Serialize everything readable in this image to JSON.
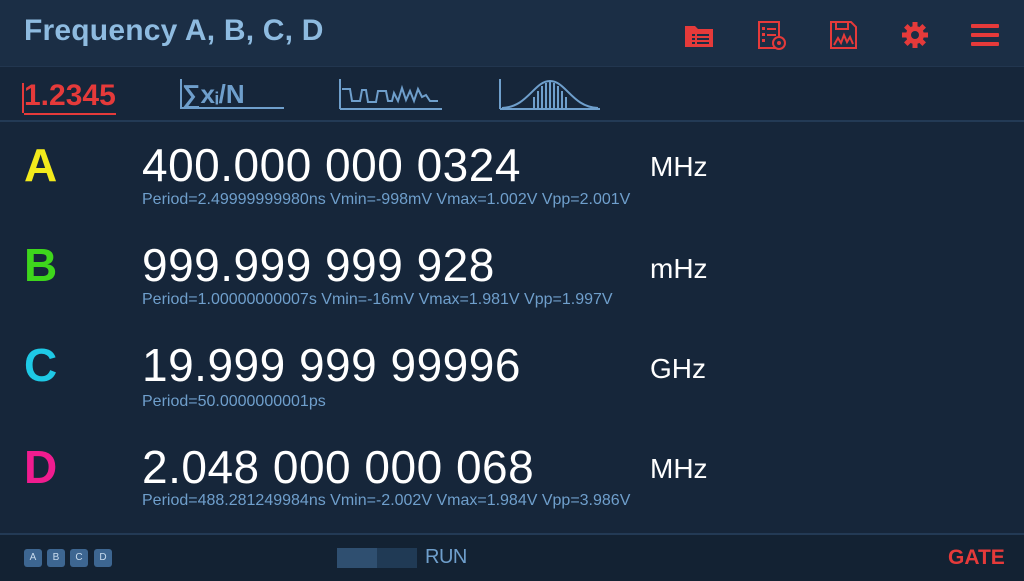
{
  "header": {
    "title": "Frequency A, B, C, D",
    "icons": [
      "folder-list-icon",
      "settings-list-icon",
      "save-chart-icon",
      "gear-icon",
      "menu-icon"
    ],
    "accent": "#e53a3a"
  },
  "modes": {
    "numeric_label": "1.2345",
    "stats_label": "∑xᵢ/N",
    "items": [
      "numeric-mode",
      "statistics-mode",
      "trend-mode",
      "histogram-mode"
    ]
  },
  "channels": [
    {
      "letter": "A",
      "color": "#f2ea1c",
      "value": "400.000 000 0324",
      "unit": "MHz",
      "meta": "Period=2.49999999980ns Vmin=-998mV Vmax=1.002V Vpp=2.001V"
    },
    {
      "letter": "B",
      "color": "#3ed61c",
      "value": "999.999 999 928",
      "unit": "mHz",
      "meta": "Period=1.00000000007s Vmin=-16mV Vmax=1.981V Vpp=1.997V"
    },
    {
      "letter": "C",
      "color": "#1ec9e6",
      "value": "19.999 999 99996",
      "unit": "GHz",
      "meta": "Period=50.0000000001ps"
    },
    {
      "letter": "D",
      "color": "#f01c8f",
      "value": "2.048 000 000 068",
      "unit": "MHz",
      "meta": "Period=488.281249984ns Vmin=-2.002V Vmax=1.984V Vpp=3.986V"
    }
  ],
  "status": {
    "chips": [
      "A",
      "B",
      "C",
      "D"
    ],
    "run_label": "RUN",
    "run_progress": 0.5,
    "gate_label": "GATE"
  }
}
